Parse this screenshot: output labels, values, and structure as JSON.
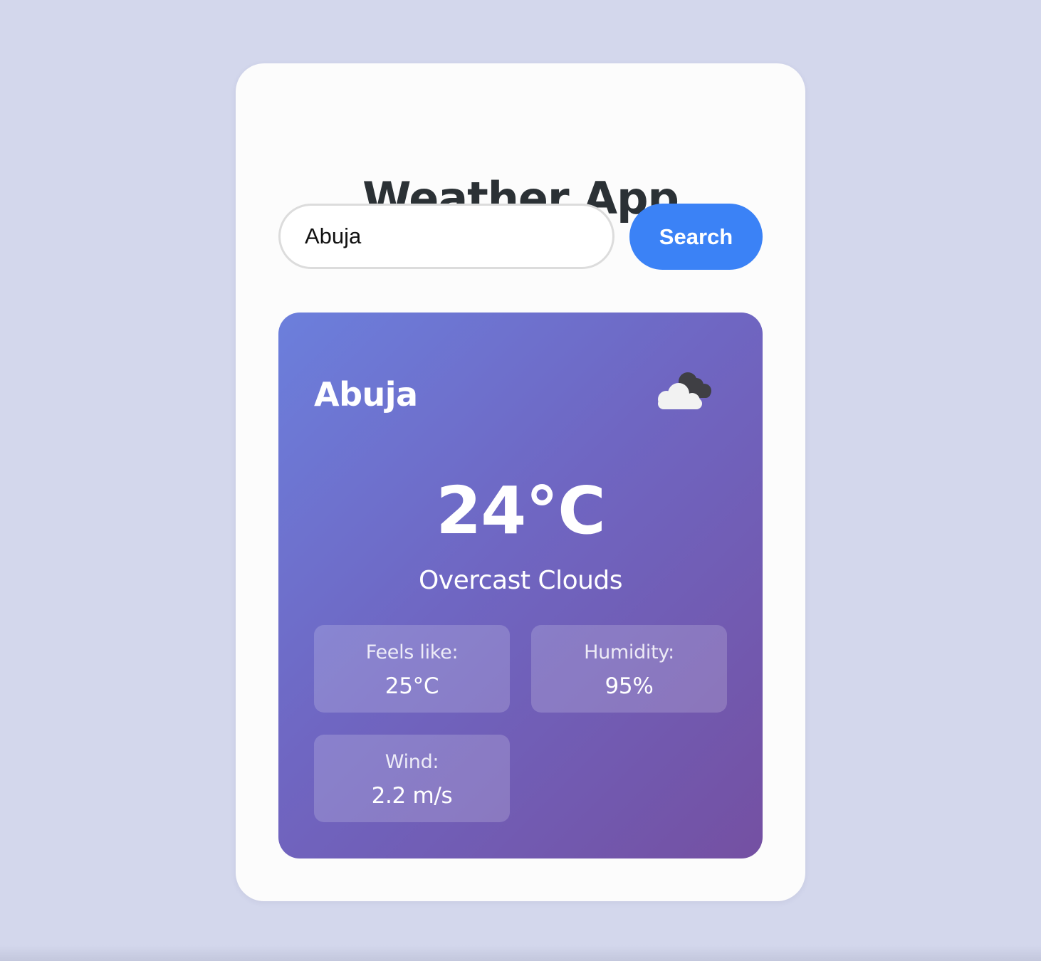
{
  "app": {
    "title": "Weather App"
  },
  "search": {
    "value": "Abuja",
    "button_label": "Search"
  },
  "weather": {
    "city": "Abuja",
    "icon": "overcast-clouds-icon",
    "temperature": "24°C",
    "description": "Overcast Clouds",
    "details": {
      "feels_like": {
        "label": "Feels like:",
        "value": "25°C"
      },
      "humidity": {
        "label": "Humidity:",
        "value": "95%"
      },
      "wind": {
        "label": "Wind:",
        "value": "2.2 m/s"
      }
    }
  },
  "colors": {
    "page_background": "#d3d7ec",
    "card_background": "#fcfcfc",
    "title_text": "#2b3135",
    "button_accent": "#3b82f6",
    "weather_gradient_start": "#6c7fdc",
    "weather_gradient_end": "#7450a2"
  }
}
